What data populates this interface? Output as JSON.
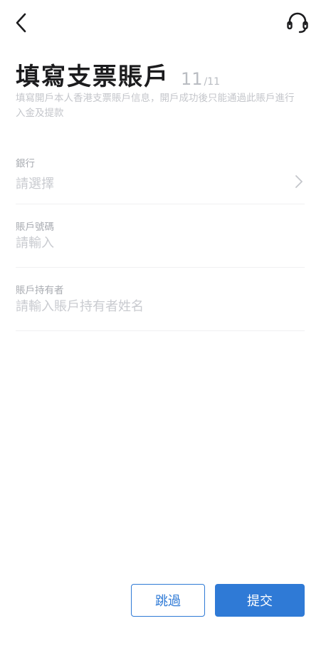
{
  "header": {
    "back_icon": "chevron-left-icon",
    "support_icon": "headset-icon"
  },
  "page": {
    "title": "填寫支票賬戶",
    "step_current": "11",
    "step_total": "/11",
    "subtitle": "填寫開戶本人香港支票賬戶信息，開戶成功後只能通過此賬戶進行入金及提款"
  },
  "form": {
    "bank": {
      "label": "銀行",
      "placeholder": "請選擇"
    },
    "account_number": {
      "label": "賬戶號碼",
      "placeholder": "請輸入"
    },
    "account_holder": {
      "label": "賬戶持有者",
      "placeholder": "請輸入賬戶持有者姓名"
    }
  },
  "actions": {
    "skip_label": "跳過",
    "submit_label": "提交"
  },
  "colors": {
    "accent": "#2f7ad6",
    "title": "#1c1c1e",
    "muted": "#c9cbd0"
  }
}
